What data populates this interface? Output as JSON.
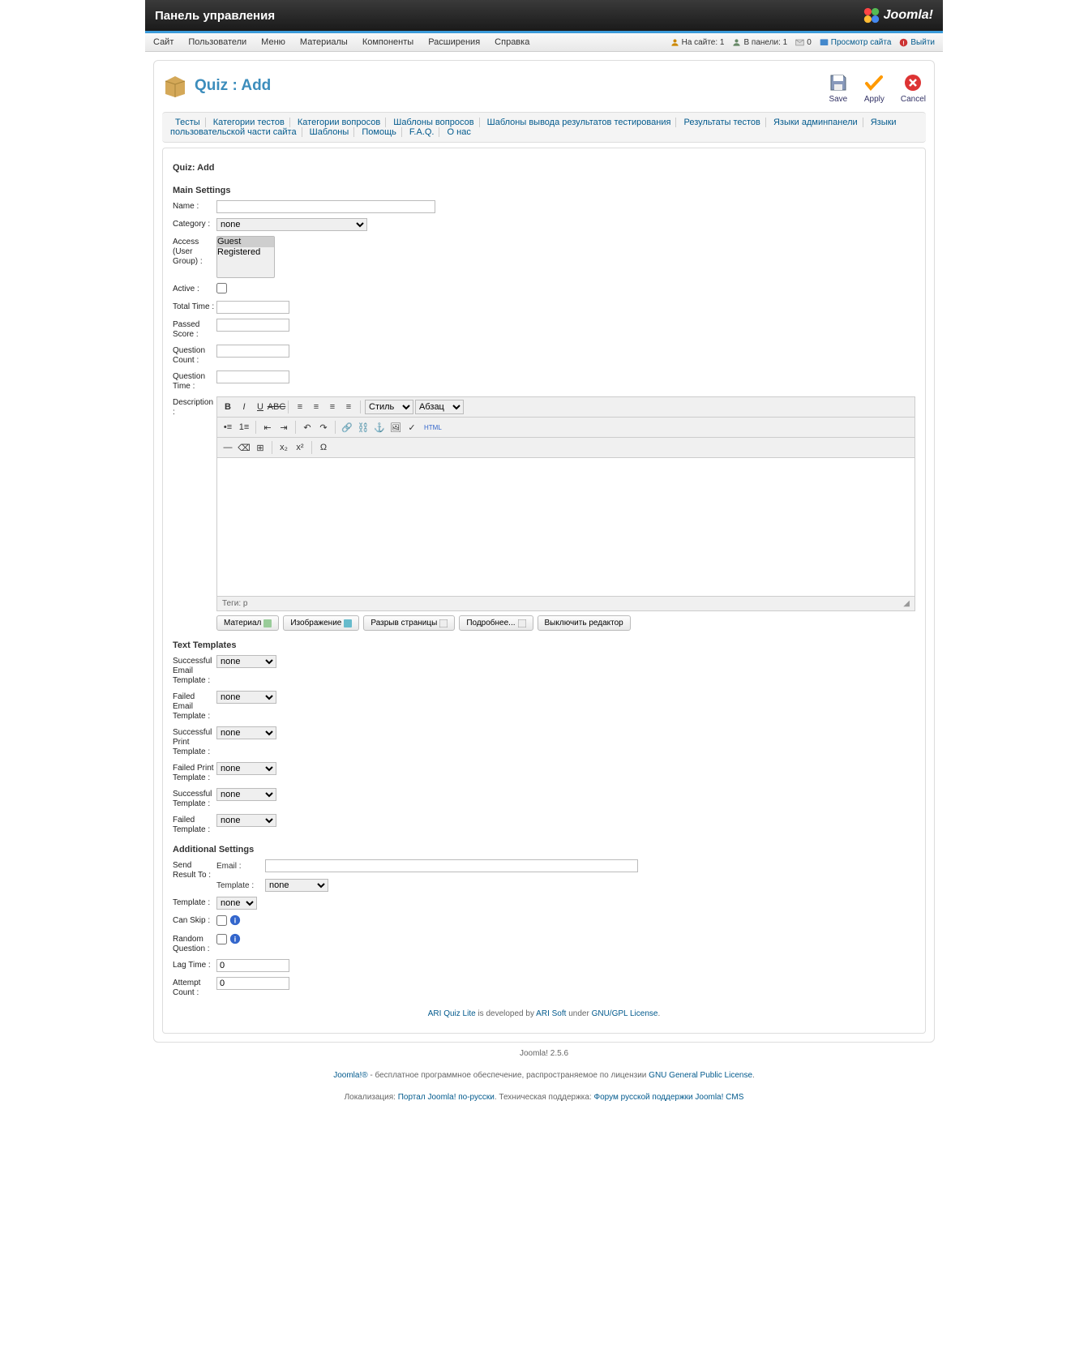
{
  "header": {
    "title": "Панель управления",
    "logo": "Joomla!"
  },
  "topmenu": {
    "left": [
      "Сайт",
      "Пользователи",
      "Меню",
      "Материалы",
      "Компоненты",
      "Расширения",
      "Справка"
    ],
    "status_site": "На сайте: 1",
    "status_panel": "В панели: 1",
    "status_mail": "0",
    "view_site": "Просмотр сайта",
    "logout": "Выйти"
  },
  "page": {
    "title": "Quiz : Add",
    "breadcrumb": "Quiz: Add"
  },
  "toolbar": {
    "save": "Save",
    "apply": "Apply",
    "cancel": "Cancel"
  },
  "tabs": [
    "Тесты",
    "Категории тестов",
    "Категории вопросов",
    "Шаблоны вопросов",
    "Шаблоны вывода результатов тестирования",
    "Результаты тестов",
    "Языки админпанели",
    "Языки пользовательской части сайта",
    "Шаблоны",
    "Помощь",
    "F.A.Q.",
    "О нас"
  ],
  "section_main": "Main Settings",
  "fields": {
    "name": "Name :",
    "name_val": "",
    "category": "Category :",
    "category_val": "none",
    "access": "Access (User Group) :",
    "access_options": [
      "Guest",
      "Registered"
    ],
    "active": "Active :",
    "total_time": "Total Time :",
    "total_time_val": "",
    "passed_score": "Passed Score :",
    "passed_score_val": "",
    "question_count": "Question Count :",
    "question_count_val": "",
    "question_time": "Question Time :",
    "question_time_val": "",
    "description": "Description :"
  },
  "editor": {
    "style": "Стиль",
    "para": "Абзац",
    "html": "HTML",
    "tags": "Теги: p",
    "btn_material": "Материал",
    "btn_image": "Изображение",
    "btn_pagebreak": "Разрыв страницы",
    "btn_more": "Подробнее...",
    "btn_toggle": "Выключить редактор"
  },
  "section_text": "Text Templates",
  "text_templates": {
    "success_email": "Successful Email Template :",
    "failed_email": "Failed Email Template :",
    "success_print": "Successful Print Template :",
    "failed_print": "Failed Print Template :",
    "success_tpl": "Successful Template :",
    "failed_tpl": "Failed Template :",
    "none": "none"
  },
  "section_additional": "Additional Settings",
  "additional": {
    "send_result_to": "Send Result To :",
    "email": "Email :",
    "email_val": "",
    "template_sub": "Template :",
    "template_sub_val": "none",
    "template": "Template :",
    "template_val": "none",
    "can_skip": "Can Skip :",
    "random_question": "Random Question :",
    "lag_time": "Lag Time :",
    "lag_time_val": "0",
    "attempt_count": "Attempt Count :",
    "attempt_count_val": "0"
  },
  "footer": {
    "ari1": "ARI Quiz Lite",
    "ari2": " is developed by ",
    "ari3": "ARI Soft",
    "ari4": " under ",
    "ari5": "GNU/GPL License",
    "version": "Joomla! 2.5.6",
    "j1": "Joomla!®",
    "j2": " - бесплатное программное обеспечение, распространяемое по лицензии ",
    "j3": "GNU General Public License",
    "loc1": "Локализация: ",
    "loc2": "Портал Joomla! по-русски",
    "loc3": ". Техническая поддержка: ",
    "loc4": "Форум русской поддержки Joomla! CMS"
  }
}
